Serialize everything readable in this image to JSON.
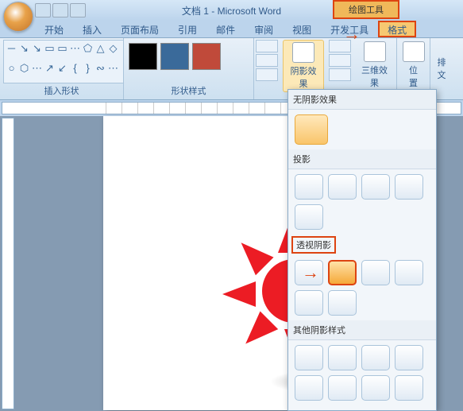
{
  "title": "文档 1 - Microsoft Word",
  "context_tab": "绘图工具",
  "tabs": {
    "items": [
      "开始",
      "插入",
      "页面布局",
      "引用",
      "邮件",
      "审阅",
      "视图",
      "开发工具",
      "格式"
    ],
    "active": "格式"
  },
  "ribbon": {
    "insert_shapes": "插入形状",
    "shape_styles": "形状样式",
    "shadow_effects": "阴影效果",
    "three_d": "三维效果",
    "position": "位置",
    "arrange": "排",
    "text": "文"
  },
  "colors": {
    "c1": "#000000",
    "c2": "#3a6a9a",
    "c3": "#c04a3a"
  },
  "dropdown": {
    "no_shadow": "无阴影效果",
    "drop_shadow": "投影",
    "perspective": "透视阴影",
    "other_styles": "其他阴影样式"
  },
  "shape_glyphs": [
    "─",
    "↘",
    "↘",
    "▭",
    "▭",
    "⋯",
    "⬠",
    "△",
    "◇",
    "○",
    "⬡",
    "⋯",
    "↗",
    "↙",
    "{",
    "}",
    "∾",
    "⋯"
  ]
}
